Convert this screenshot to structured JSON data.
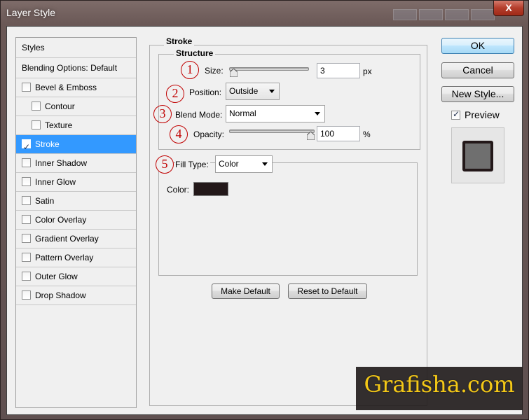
{
  "window": {
    "title": "Layer Style",
    "close_label": "X"
  },
  "styles_list": {
    "header": "Styles",
    "blending": "Blending Options: Default",
    "items": [
      {
        "label": "Bevel & Emboss",
        "checked": false,
        "sub": false
      },
      {
        "label": "Contour",
        "checked": false,
        "sub": true
      },
      {
        "label": "Texture",
        "checked": false,
        "sub": true
      },
      {
        "label": "Stroke",
        "checked": true,
        "sub": false,
        "selected": true
      },
      {
        "label": "Inner Shadow",
        "checked": false,
        "sub": false
      },
      {
        "label": "Inner Glow",
        "checked": false,
        "sub": false
      },
      {
        "label": "Satin",
        "checked": false,
        "sub": false
      },
      {
        "label": "Color Overlay",
        "checked": false,
        "sub": false
      },
      {
        "label": "Gradient Overlay",
        "checked": false,
        "sub": false
      },
      {
        "label": "Pattern Overlay",
        "checked": false,
        "sub": false
      },
      {
        "label": "Outer Glow",
        "checked": false,
        "sub": false
      },
      {
        "label": "Drop Shadow",
        "checked": false,
        "sub": false
      }
    ]
  },
  "stroke": {
    "title": "Stroke",
    "structure_title": "Structure",
    "size": {
      "label": "Size:",
      "value": "3",
      "unit": "px",
      "slider_fraction": 0.01
    },
    "position": {
      "label": "Position:",
      "value": "Outside"
    },
    "blend_mode": {
      "label": "Blend Mode:",
      "value": "Normal"
    },
    "opacity": {
      "label": "Opacity:",
      "value": "100",
      "unit": "%",
      "slider_fraction": 1.0
    },
    "fill_type": {
      "label": "Fill Type:",
      "value": "Color"
    },
    "color": {
      "label": "Color:",
      "value": "#231819"
    },
    "make_default": "Make Default",
    "reset_default": "Reset to Default"
  },
  "annotations": [
    "1",
    "2",
    "3",
    "4",
    "5"
  ],
  "buttons": {
    "ok": "OK",
    "cancel": "Cancel",
    "new_style": "New Style..."
  },
  "preview": {
    "label": "Preview",
    "checked": true
  },
  "watermark": "Grafisha.com",
  "colors": {
    "selected": "#3399ff",
    "annotation": "#c00000",
    "watermark_text": "#f5c400"
  }
}
